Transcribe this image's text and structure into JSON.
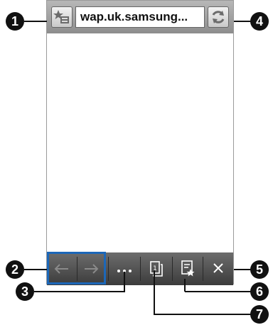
{
  "browser": {
    "url": "wap.uk.samsung..."
  },
  "callouts": [
    "1",
    "2",
    "3",
    "4",
    "5",
    "6",
    "7"
  ],
  "icons": {
    "favorites": "favorites-icon",
    "refresh": "refresh-icon",
    "back": "back-arrow-icon",
    "forward": "forward-arrow-icon",
    "more": "more-icon",
    "windows": "windows-icon",
    "add_bookmark": "add-bookmark-icon",
    "close": "close-icon"
  },
  "colors": {
    "highlight": "#1c67b8",
    "callout": "#111111"
  }
}
